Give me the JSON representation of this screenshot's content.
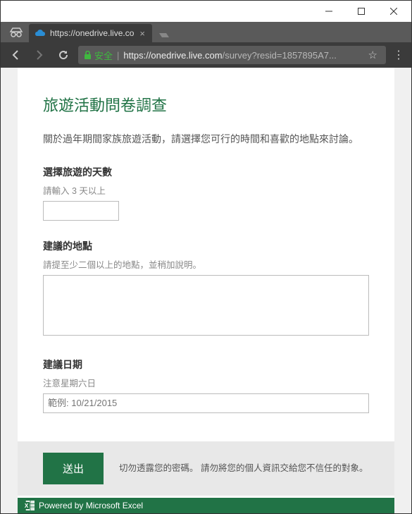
{
  "window": {
    "minimize": "–",
    "maximize": "☐",
    "close": "✕"
  },
  "browser": {
    "tab_title": "https://onedrive.live.co",
    "secure_label": "安全",
    "url_host": "https://onedrive.live.com",
    "url_path": "/survey?resid=1857895A7..."
  },
  "survey": {
    "title": "旅遊活動問卷調查",
    "description": "關於過年期間家族旅遊活動，請選擇您可行的時間和喜歡的地點來討論。",
    "fields": {
      "days": {
        "label": "選擇旅遊的天數",
        "hint": "請輸入 3 天以上"
      },
      "place": {
        "label": "建議的地點",
        "hint": "請提至少二個以上的地點，並稍加說明。"
      },
      "date": {
        "label": "建議日期",
        "hint": "注意星期六日",
        "placeholder": "範例: 10/21/2015"
      }
    },
    "submit_label": "送出",
    "footer_note": "切勿透露您的密碼。 請勿將您的個人資訊交給您不信任的對象。",
    "powered_by": "Powered by Microsoft Excel"
  }
}
